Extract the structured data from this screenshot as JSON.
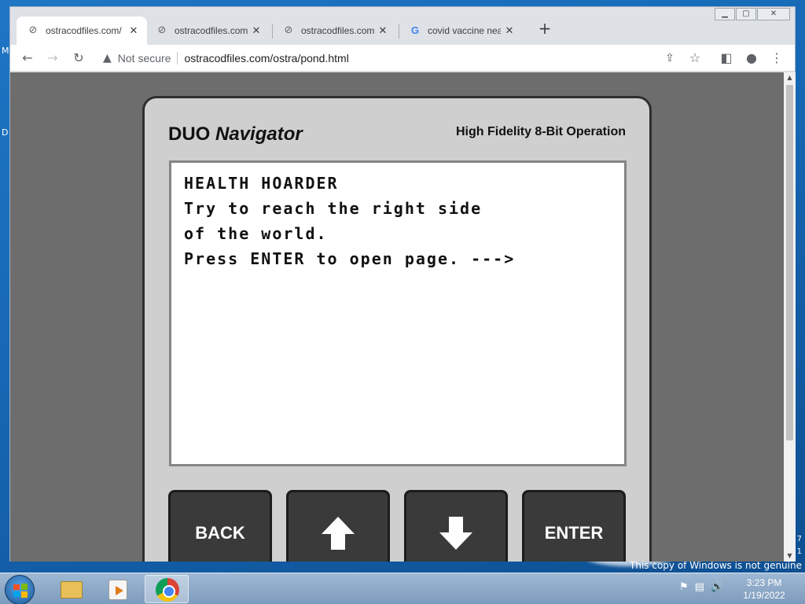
{
  "browser": {
    "tabs": [
      {
        "title": "ostracodfiles.com/",
        "favicon": "ostracod-icon",
        "active": true
      },
      {
        "title": "ostracodfiles.com/",
        "favicon": "ostracod-icon",
        "active": false
      },
      {
        "title": "ostracodfiles.com/",
        "favicon": "ostracod-icon",
        "active": false
      },
      {
        "title": "covid vaccine near",
        "favicon": "google-icon",
        "active": false
      }
    ],
    "security_label": "Not secure",
    "url": "ostracodfiles.com/ostra/pond.html"
  },
  "device": {
    "brand": "DUO",
    "brand_italic": "Navigator",
    "tagline": "High Fidelity 8-Bit Operation",
    "screen_lines": [
      "HEALTH HOARDER",
      "Try to reach the right side",
      "of the world.",
      "",
      "Press ENTER to open page. --->"
    ],
    "buttons": {
      "back": "BACK",
      "up": "up-arrow-icon",
      "down": "down-arrow-icon",
      "enter": "ENTER"
    }
  },
  "desktop": {
    "left_edge_labels": [
      "M",
      "D"
    ],
    "right_edge_labels": [
      "7",
      "1"
    ],
    "genuine_notice": "This copy of Windows is not genuine"
  },
  "taskbar": {
    "time": "3:23 PM",
    "date": "1/19/2022"
  }
}
